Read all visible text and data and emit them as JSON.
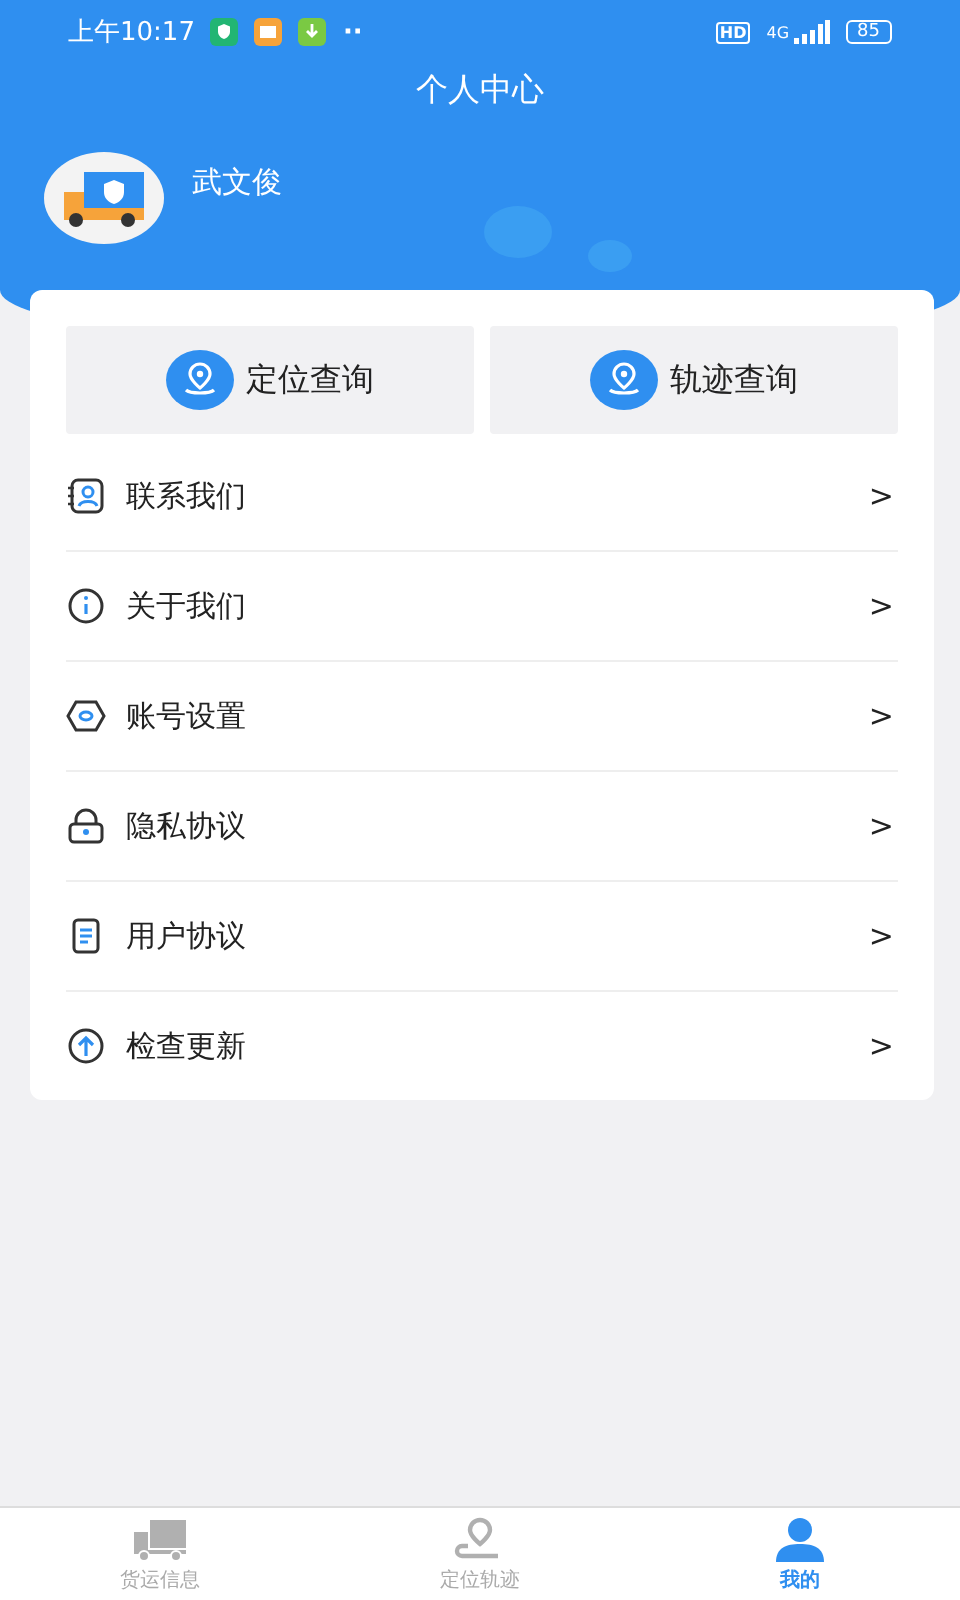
{
  "status_bar": {
    "time": "上午10:17",
    "more": "··",
    "hd": "HD",
    "network": "4G",
    "battery": "85"
  },
  "title": "个人中心",
  "profile": {
    "name": "武文俊"
  },
  "quick_actions": [
    {
      "label": "定位查询"
    },
    {
      "label": "轨迹查询"
    }
  ],
  "menu": [
    {
      "kind": "contact",
      "label": "联系我们",
      "chevron": ">"
    },
    {
      "kind": "info",
      "label": "关于我们",
      "chevron": ">"
    },
    {
      "kind": "account",
      "label": "账号设置",
      "chevron": ">"
    },
    {
      "kind": "privacy",
      "label": "隐私协议",
      "chevron": ">"
    },
    {
      "kind": "agreement",
      "label": "用户协议",
      "chevron": ">"
    },
    {
      "kind": "update",
      "label": "检查更新",
      "chevron": ">"
    }
  ],
  "tabs": [
    {
      "kind": "truck",
      "label": "货运信息",
      "selected": false
    },
    {
      "kind": "route",
      "label": "定位轨迹",
      "selected": false
    },
    {
      "kind": "person",
      "label": "我的",
      "selected": true
    }
  ]
}
